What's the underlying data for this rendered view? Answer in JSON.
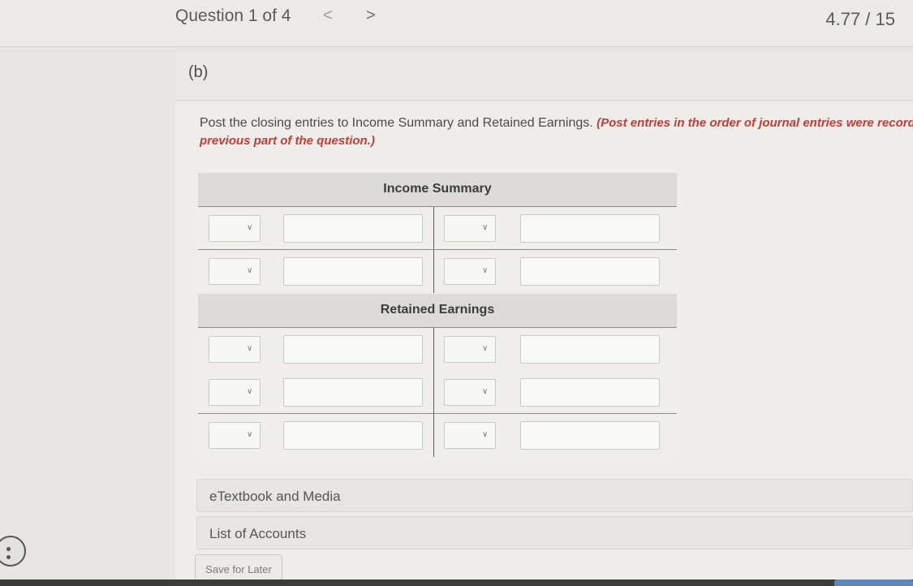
{
  "header": {
    "question_label": "Question 1 of 4",
    "prev_glyph": "<",
    "next_glyph": ">",
    "score": "4.77 / 15"
  },
  "part": {
    "label": "(b)"
  },
  "instructions": {
    "text": "Post the closing entries to Income Summary and Retained Earnings. ",
    "emphasis_line1": "(Post entries in the order of journal entries were recorded i",
    "emphasis_line2": "previous part of the question.)"
  },
  "accounts": [
    {
      "title": "Income Summary",
      "rows": 2
    },
    {
      "title": "Retained Earnings",
      "rows": 3
    }
  ],
  "sections": {
    "etextbook": "eTextbook and Media",
    "list_of_accounts": "List of Accounts"
  },
  "buttons": {
    "save_for_later": "Save for Later"
  },
  "icons": {
    "dropdown": "chevron-down-icon",
    "help": "help-icon"
  },
  "colors": {
    "emphasis": "#c43c3c",
    "page_bg": "#e7e6e3",
    "header_bg": "#dcdbd8"
  }
}
